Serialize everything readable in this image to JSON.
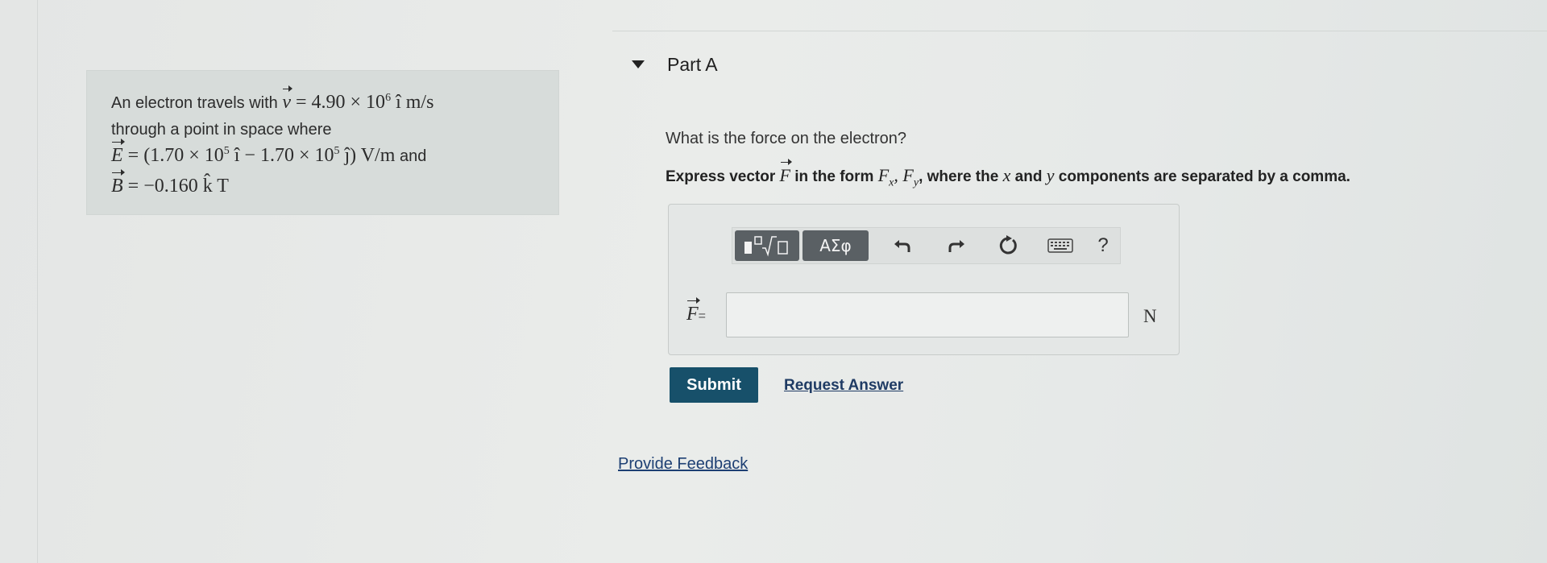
{
  "problem": {
    "line1_text": "An electron travels with",
    "line1_math": "= 4.90 × 10",
    "line1_exp": "6",
    "line1_unit": "î m/s",
    "line2_text": "through a point in space where",
    "E_symbol": "E",
    "E_part1": "= (1.70 × 10",
    "E_exp1": "5",
    "E_part2": "î − 1.70 × 10",
    "E_exp2": "5",
    "E_part3": "ĵ) V/m",
    "E_and": "and",
    "B_symbol": "B",
    "B_value": "= −0.160 k̂ T"
  },
  "part": {
    "title": "Part A",
    "question": "What is the force on the electron?",
    "instruction_pre": "Express vector",
    "instruction_symbol": "F",
    "instruction_mid": "in the form",
    "instruction_form": "F",
    "instruction_form_sub_x": "x",
    "instruction_form_sep": ", F",
    "instruction_form_sub_y": "y",
    "instruction_post": ", where the",
    "instruction_x": "x",
    "instruction_and": "and",
    "instruction_y": "y",
    "instruction_end": "components are separated by a comma."
  },
  "toolbar": {
    "templates_icon": "templates-icon",
    "greek_label": "ΑΣφ",
    "undo_icon": "undo-icon",
    "redo_icon": "redo-icon",
    "reset_icon": "reset-icon",
    "keyboard_icon": "keyboard-icon",
    "help_label": "?"
  },
  "answer": {
    "symbol": "F",
    "equals": "=",
    "value": "",
    "unit": "N"
  },
  "actions": {
    "submit_label": "Submit",
    "request_label": "Request Answer",
    "feedback_label": "Provide Feedback"
  },
  "colors": {
    "submit_bg": "#17506a",
    "toolbar_btn_bg": "#5a6064",
    "link": "#1d3f73"
  }
}
